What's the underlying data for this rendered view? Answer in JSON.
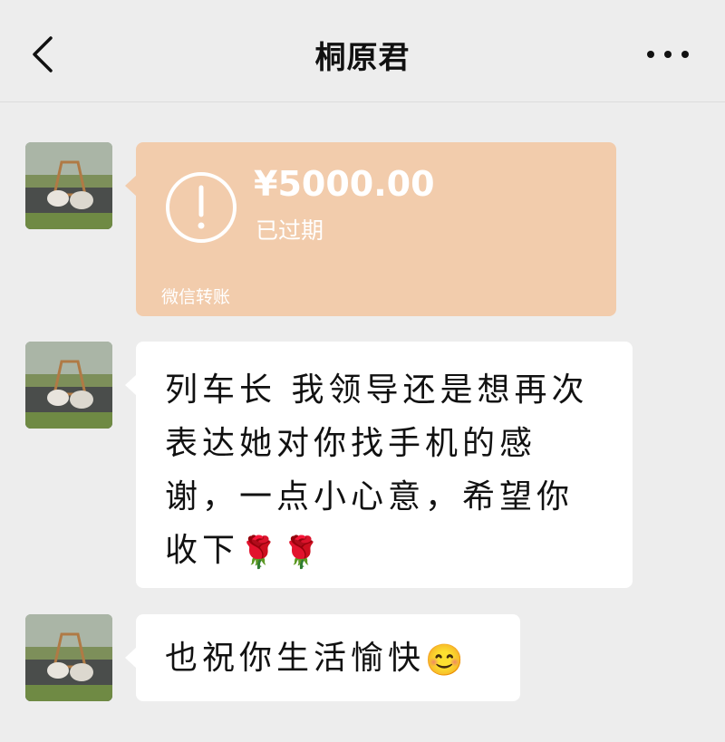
{
  "header": {
    "title": "桐原君"
  },
  "messages": [
    {
      "type": "transfer",
      "amount": "¥5000.00",
      "status": "已过期",
      "label": "微信转账"
    },
    {
      "type": "text",
      "text": "列车长 我领导还是想再次\n表达她对你找手机的感\n谢，一点小心意，希望你\n收下",
      "emoji": "🌹🌹"
    },
    {
      "type": "text",
      "text": "也祝你生活愉快",
      "emoji": "😊"
    }
  ],
  "icons": {
    "back": "back-arrow-icon",
    "more": "more-dots-icon",
    "transfer": "exclamation-circle-icon"
  },
  "colors": {
    "background": "#ededed",
    "transfer_bubble": "#f2ccac",
    "text_bubble": "#ffffff"
  }
}
